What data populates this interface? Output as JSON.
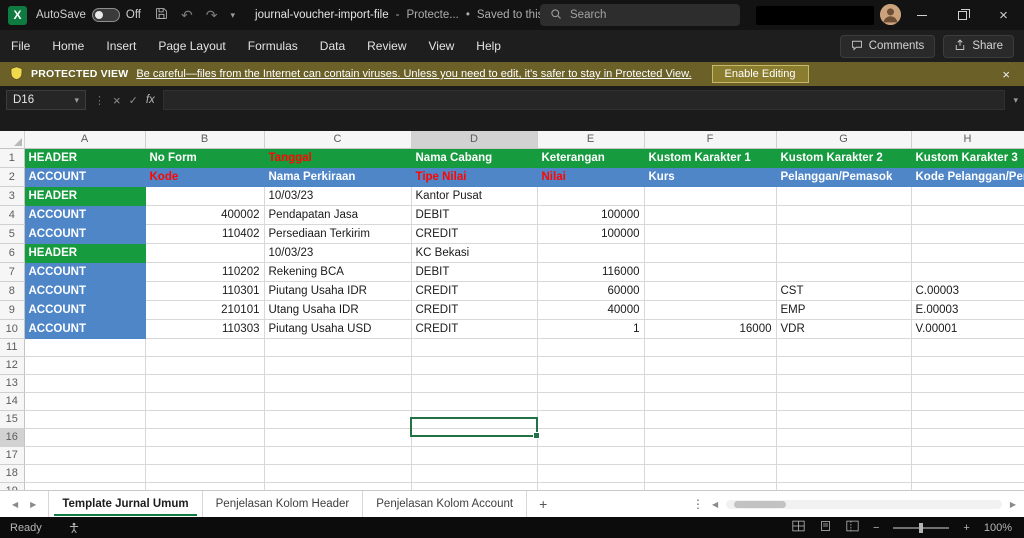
{
  "titlebar": {
    "autosave_label": "AutoSave",
    "autosave_state": "Off",
    "file_name": "journal-voucher-import-file",
    "sep1": "-",
    "mode_hint": "Protecte...",
    "sep2": "•",
    "saved_status": "Saved to this PC",
    "search_placeholder": "Search"
  },
  "ribbon": {
    "tabs": [
      "File",
      "Home",
      "Insert",
      "Page Layout",
      "Formulas",
      "Data",
      "Review",
      "View",
      "Help"
    ],
    "comments_label": "Comments",
    "share_label": "Share"
  },
  "message_bar": {
    "badge": "PROTECTED VIEW",
    "message": "Be careful—files from the Internet can contain viruses. Unless you need to edit, it's safer to stay in Protected View.",
    "action": "Enable Editing"
  },
  "formula_bar": {
    "name_box": "D16",
    "fx_label": "fx",
    "formula_value": ""
  },
  "grid": {
    "columns": [
      "A",
      "B",
      "C",
      "D",
      "E",
      "F",
      "G",
      "H"
    ],
    "row_numbers": [
      "1",
      "2",
      "3",
      "4",
      "5",
      "6",
      "7",
      "8",
      "9",
      "10",
      "11",
      "12",
      "13",
      "14",
      "15",
      "16",
      "17",
      "18",
      "19"
    ],
    "selection": "D16",
    "cells": {
      "r1": {
        "A": "HEADER",
        "B": "No Form",
        "C": "Tanggal",
        "D": "Nama Cabang",
        "E": "Keterangan",
        "F": "Kustom Karakter 1",
        "G": "Kustom Karakter 2",
        "H": "Kustom Karakter 3"
      },
      "r2": {
        "A": "ACCOUNT",
        "B": "Kode",
        "C": "Nama Perkiraan",
        "D": "Tipe Nilai",
        "E": "Nilai",
        "F": "Kurs",
        "G": "Pelanggan/Pemasok",
        "H": "Kode Pelanggan/Pemasok"
      },
      "r3": {
        "A": "HEADER",
        "C": "10/03/23",
        "D": "Kantor Pusat"
      },
      "r4": {
        "A": "ACCOUNT",
        "B": "400002",
        "C": "Pendapatan Jasa",
        "D": "DEBIT",
        "E": "100000"
      },
      "r5": {
        "A": "ACCOUNT",
        "B": "110402",
        "C": "Persediaan Terkirim",
        "D": "CREDIT",
        "E": "100000"
      },
      "r6": {
        "A": "HEADER",
        "C": "10/03/23",
        "D": "KC Bekasi"
      },
      "r7": {
        "A": "ACCOUNT",
        "B": "110202",
        "C": "Rekening BCA",
        "D": "DEBIT",
        "E": "116000"
      },
      "r8": {
        "A": "ACCOUNT",
        "B": "110301",
        "C": "Piutang Usaha IDR",
        "D": "CREDIT",
        "E": "60000",
        "G": "CST",
        "H": "C.00003"
      },
      "r9": {
        "A": "ACCOUNT",
        "B": "210101",
        "C": "Utang Usaha IDR",
        "D": "CREDIT",
        "E": "40000",
        "G": "EMP",
        "H": "E.00003"
      },
      "r10": {
        "A": "ACCOUNT",
        "B": "110303",
        "C": "Piutang Usaha USD",
        "D": "CREDIT",
        "E": "1",
        "F": "16000",
        "G": "VDR",
        "H": "V.00001"
      }
    }
  },
  "sheet_tabs": {
    "tabs": [
      "Template Jurnal Umum",
      "Penjelasan Kolom Header",
      "Penjelasan Kolom Account"
    ],
    "active_tab": "Template Jurnal Umum",
    "add": "+"
  },
  "status_bar": {
    "ready": "Ready",
    "zoom": "100%"
  },
  "colors": {
    "header_green": "#169b3e",
    "account_blue": "#4e86c8",
    "alert_red": "#ff0600",
    "excel_accent_green": "#107c41",
    "message_bar_olive": "#6a6028"
  }
}
